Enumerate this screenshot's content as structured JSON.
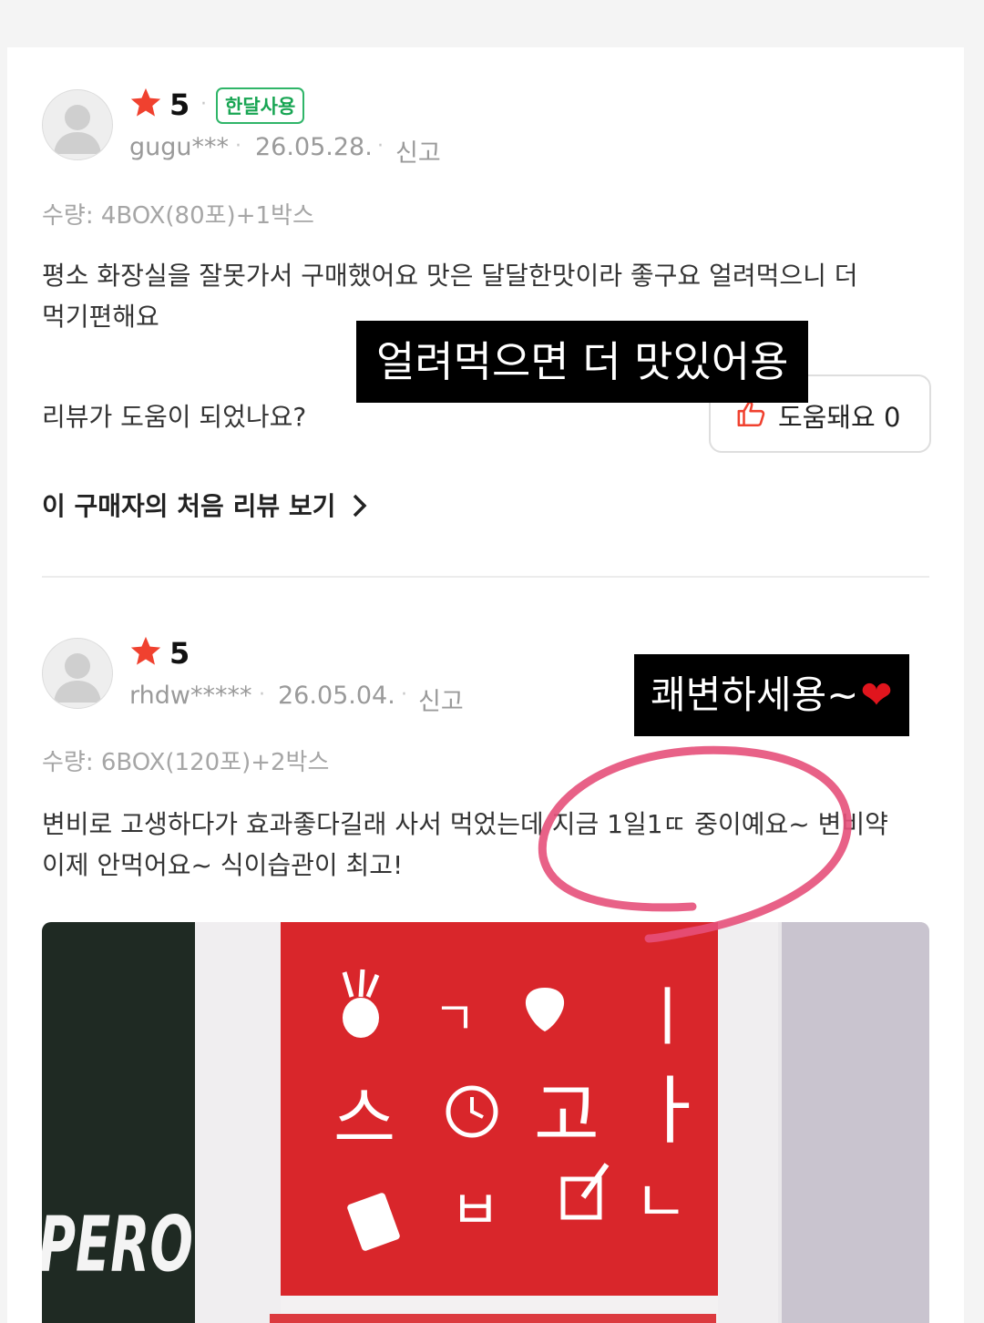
{
  "reviews": [
    {
      "rating": "5",
      "badge": "한달사용",
      "username": "gugu***",
      "date": "26.05.28.",
      "report": "신고",
      "quantity": "수량: 4BOX(80포)+1박스",
      "text_line1": "평소 화장실을 잘못가서 구매했어요 맛은 달달한맛이라 좋구요 얼려먹으니 더",
      "text_line2": "먹기편해요",
      "helpful_question": "리뷰가 도움이 되었나요?",
      "helpful_button": "도움돼요 0",
      "first_review_link": "이 구매자의 처음 리뷰 보기"
    },
    {
      "rating": "5",
      "username": "rhdw*****",
      "date": "26.05.04.",
      "report": "신고",
      "quantity": "수량: 6BOX(120포)+2박스",
      "text_line1": "변비로 고생하다가 효과좋다길래 사서 먹었는데 지금 1일1ㄸ 중이예요~ 변비약",
      "text_line2": "이제 안먹어요~ 식이습관이 최고!"
    }
  ],
  "overlays": {
    "caption1": "얼려먹으면 더 맛있어용",
    "caption2": "쾌변하세용~",
    "heart": "❤"
  },
  "photo": {
    "sign_letters": [
      "ㄱ",
      "ㅣ",
      "스",
      "고",
      "ㅏ",
      "ㅂ",
      "ㄴ"
    ],
    "side_text": "PERO"
  },
  "colors": {
    "star": "#f0412f",
    "badge": "#18a553",
    "sign_red": "#d9262b",
    "annotation_pink": "#e6507a"
  },
  "icons": [
    "star-icon",
    "thumbs-up-icon",
    "chevron-right-icon",
    "user-avatar-icon",
    "heart-icon"
  ]
}
